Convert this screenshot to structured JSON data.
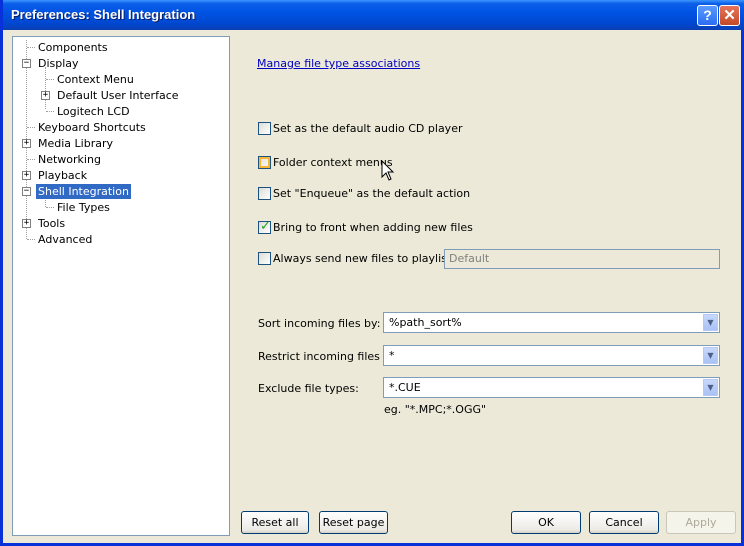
{
  "window": {
    "title": "Preferences: Shell Integration"
  },
  "tree": {
    "items": [
      {
        "label": "Components"
      },
      {
        "label": "Display"
      },
      {
        "label": "Context Menu"
      },
      {
        "label": "Default User Interface"
      },
      {
        "label": "Logitech LCD"
      },
      {
        "label": "Keyboard Shortcuts"
      },
      {
        "label": "Media Library"
      },
      {
        "label": "Networking"
      },
      {
        "label": "Playback"
      },
      {
        "label": "Shell Integration"
      },
      {
        "label": "File Types"
      },
      {
        "label": "Tools"
      },
      {
        "label": "Advanced"
      }
    ]
  },
  "panel": {
    "link": "Manage file type associations",
    "checkboxes": [
      {
        "label": "Set as the default audio CD player",
        "checked": false
      },
      {
        "label": "Folder context menus",
        "checked": false
      },
      {
        "label": "Set \"Enqueue\" as the default action",
        "checked": false
      },
      {
        "label": "Bring to front when adding new files",
        "checked": true
      },
      {
        "label": "Always send new files to playlist:",
        "checked": false
      }
    ],
    "playlist_placeholder": "Default",
    "sort_label": "Sort incoming files by:",
    "sort_value": "%path_sort%",
    "restrict_label": "Restrict incoming files to:",
    "restrict_value": "*",
    "exclude_label": "Exclude file types:",
    "exclude_value": "*.CUE",
    "exclude_hint": "eg. \"*.MPC;*.OGG\""
  },
  "buttons": {
    "reset_all": "Reset all",
    "reset_page": "Reset page",
    "ok": "OK",
    "cancel": "Cancel",
    "apply": "Apply"
  }
}
